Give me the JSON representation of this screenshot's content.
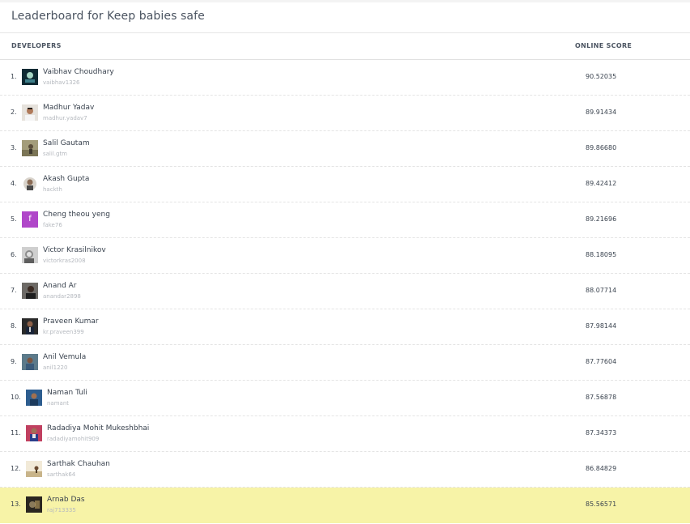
{
  "page": {
    "title": "Leaderboard for Keep babies safe"
  },
  "table": {
    "headers": {
      "developers": "DEVELOPERS",
      "score": "ONLINE SCORE"
    },
    "highlight_color": "#f7f3a7",
    "rows": [
      {
        "rank": "1.",
        "name": "Vaibhav Choudhary",
        "handle": "vaibhav1326",
        "score": "90.52035",
        "avatar": "vaibhav-avatar-icon"
      },
      {
        "rank": "2.",
        "name": "Madhur Yadav",
        "handle": "madhur.yadav7",
        "score": "89.91434",
        "avatar": "madhur-avatar-icon"
      },
      {
        "rank": "3.",
        "name": "Salil Gautam",
        "handle": "salil.gtm",
        "score": "89.86680",
        "avatar": "salil-avatar-icon"
      },
      {
        "rank": "4.",
        "name": "Akash Gupta",
        "handle": "hackth",
        "score": "89.42412",
        "avatar": "akash-avatar-icon"
      },
      {
        "rank": "5.",
        "name": "Cheng theou yeng",
        "handle": "fake76",
        "score": "89.21696",
        "avatar": "letter-avatar-f",
        "letter": "f",
        "avatar_color": "#b047c9"
      },
      {
        "rank": "6.",
        "name": "Victor Krasilnikov",
        "handle": "victorkras2008",
        "score": "88.18095",
        "avatar": "victor-avatar-icon"
      },
      {
        "rank": "7.",
        "name": "Anand Ar",
        "handle": "anandar2898",
        "score": "88.07714",
        "avatar": "anand-avatar-icon"
      },
      {
        "rank": "8.",
        "name": "Praveen Kumar",
        "handle": "kr.praveen399",
        "score": "87.98144",
        "avatar": "praveen-avatar-icon"
      },
      {
        "rank": "9.",
        "name": "Anil Vemula",
        "handle": "anil1220",
        "score": "87.77604",
        "avatar": "anil-avatar-icon"
      },
      {
        "rank": "10.",
        "name": "Naman Tuli",
        "handle": "namant",
        "score": "87.56878",
        "avatar": "naman-avatar-icon"
      },
      {
        "rank": "11.",
        "name": "Radadiya Mohit Mukeshbhai",
        "handle": "radadiyamohit909",
        "score": "87.34373",
        "avatar": "radadiya-avatar-icon"
      },
      {
        "rank": "12.",
        "name": "Sarthak Chauhan",
        "handle": "sarthak64",
        "score": "86.84829",
        "avatar": "sarthak-avatar-icon"
      },
      {
        "rank": "13.",
        "name": "Arnab Das",
        "handle": "raj713335",
        "score": "85.56571",
        "avatar": "arnab-avatar-icon",
        "highlight": true
      }
    ]
  }
}
